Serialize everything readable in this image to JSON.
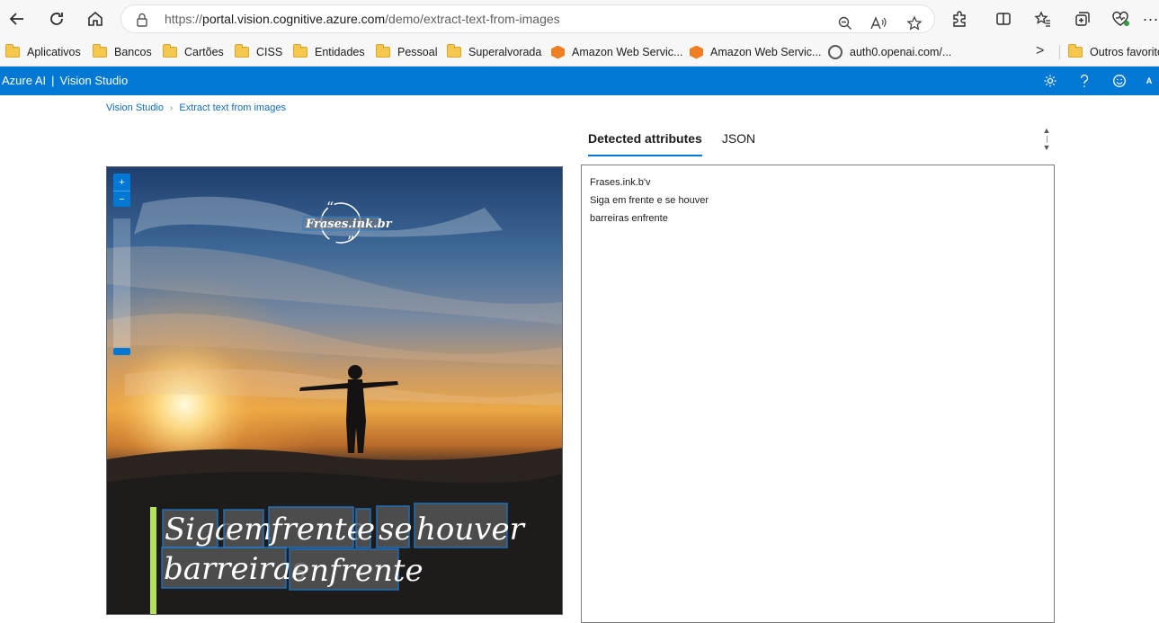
{
  "browser": {
    "url_prefix": "https://",
    "url_host": "portal.vision.cognitive.azure.com",
    "url_path": "/demo/extract-text-from-images",
    "back_icon": "←",
    "reload_icon": "⟳",
    "home_icon": "⌂",
    "more_icon": "···"
  },
  "bookmarks": {
    "items": [
      {
        "label": "Aplicativos",
        "icon": "folder-icon"
      },
      {
        "label": "Bancos",
        "icon": "folder-icon"
      },
      {
        "label": "Cartões",
        "icon": "folder-icon"
      },
      {
        "label": "CISS",
        "icon": "folder-icon"
      },
      {
        "label": "Entidades",
        "icon": "folder-icon"
      },
      {
        "label": "Pessoal",
        "icon": "folder-icon"
      },
      {
        "label": "Superalvorada",
        "icon": "folder-icon"
      },
      {
        "label": "Amazon Web Servic...",
        "icon": "aws-cube-icon"
      },
      {
        "label": "Amazon Web Servic...",
        "icon": "aws-cube-icon"
      },
      {
        "label": "auth0.openai.com/...",
        "icon": "openai-icon"
      }
    ],
    "overflow": ">",
    "other_favorites": "Outros favorito"
  },
  "app": {
    "brand": "Azure AI",
    "separator": "|",
    "product": "Vision Studio",
    "avatar": "A"
  },
  "breadcrumb": {
    "root": "Vision Studio",
    "current": "Extract text from images"
  },
  "image_viewer": {
    "zoom_in": "+",
    "zoom_out": "−",
    "zoom_level": 0.05,
    "detected_text": {
      "logo": "Frases.ink.br",
      "line1_words": [
        "Siga",
        "em",
        "frente",
        "e",
        "se",
        "houver"
      ],
      "line2_words": [
        "barreiras",
        "enfrente"
      ]
    }
  },
  "tabs": [
    {
      "label": "Detected attributes",
      "active": true
    },
    {
      "label": "JSON",
      "active": false
    }
  ],
  "results": {
    "lines": [
      "Frases.ink.b'v",
      "Siga em frente e se houver",
      "barreiras enfrente"
    ]
  },
  "colors": {
    "accent": "#0078d4",
    "bounding_box": "#1e7fd6",
    "quote_bar": "#b6e15a"
  }
}
